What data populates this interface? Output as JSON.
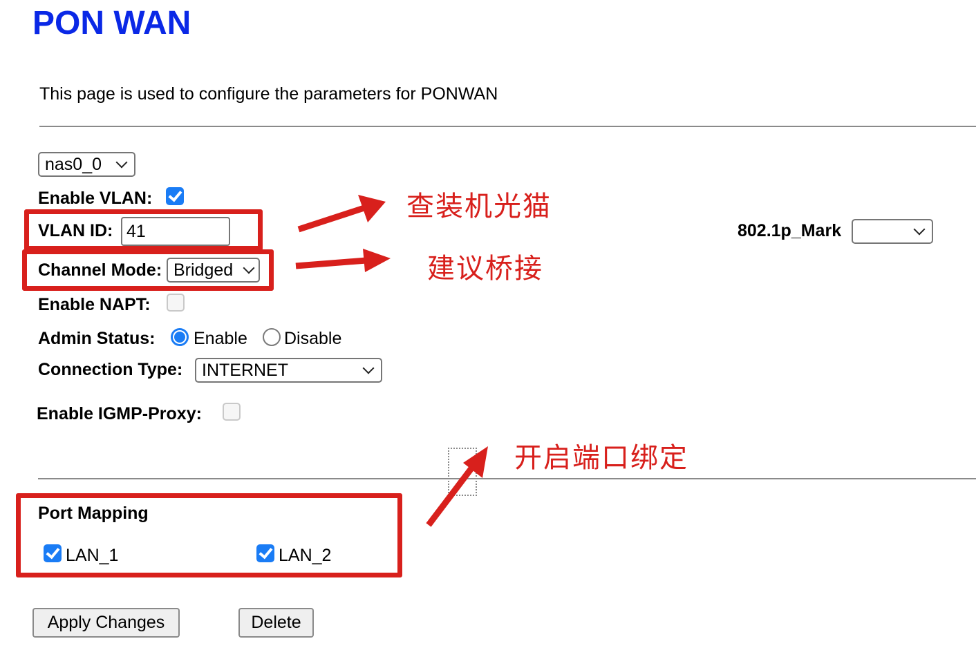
{
  "header": {
    "title": "PON WAN",
    "description": "This page is used to configure the parameters for PONWAN"
  },
  "form": {
    "interface_select": {
      "value": "nas0_0"
    },
    "enable_vlan": {
      "label": "Enable VLAN:",
      "checked": true
    },
    "vlan_id": {
      "label": "VLAN ID:",
      "value": "41"
    },
    "mark_8021p": {
      "label": "802.1p_Mark",
      "value": ""
    },
    "channel_mode": {
      "label": "Channel Mode:",
      "value": "Bridged"
    },
    "enable_napt": {
      "label": "Enable NAPT:",
      "checked": false
    },
    "admin_status": {
      "label": "Admin Status:",
      "options": [
        {
          "label": "Enable",
          "selected": true
        },
        {
          "label": "Disable",
          "selected": false
        }
      ]
    },
    "connection_type": {
      "label": "Connection Type:",
      "value": "INTERNET"
    },
    "enable_igmp_proxy": {
      "label": "Enable IGMP-Proxy:",
      "checked": false
    }
  },
  "port_mapping": {
    "title": "Port Mapping",
    "ports": [
      {
        "label": "LAN_1",
        "checked": true
      },
      {
        "label": "LAN_2",
        "checked": true
      }
    ]
  },
  "buttons": {
    "apply": "Apply Changes",
    "delete": "Delete"
  },
  "annotations": {
    "vlan_note": "查装机光猫",
    "bridge_note": "建议桥接",
    "port_binding_note": "开启端口绑定",
    "color": "#d8201c"
  }
}
